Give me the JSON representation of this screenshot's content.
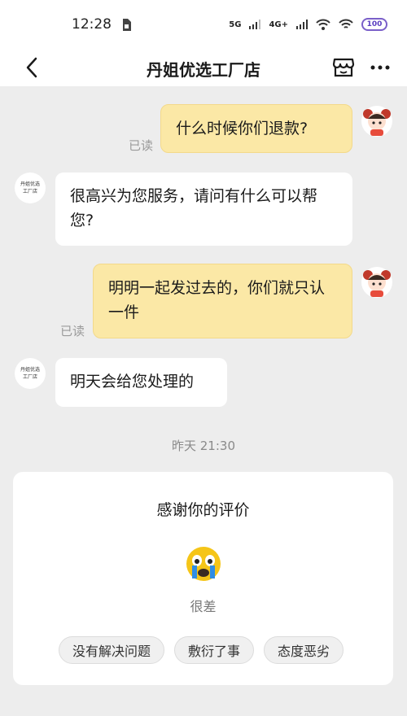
{
  "status_bar": {
    "time": "12:28",
    "network_1": "5G",
    "network_2": "4G+",
    "battery": "100"
  },
  "header": {
    "title": "丹姐优选工厂店"
  },
  "messages": [
    {
      "direction": "out",
      "text": "什么时候你们退款?",
      "read_label": "已读"
    },
    {
      "direction": "in",
      "text": "很高兴为您服务，请问有什么可以帮您?"
    },
    {
      "direction": "out",
      "text": "明明一起发过去的，你们就只认一件",
      "read_label": "已读"
    },
    {
      "direction": "in",
      "text": "明天会给您处理的"
    }
  ],
  "shop_avatar": {
    "line1": "丹姐优选",
    "line2": "工厂店"
  },
  "timestamp": "昨天 21:30",
  "review": {
    "title": "感谢你的评价",
    "rating_label": "很差",
    "tags": [
      "没有解决问题",
      "敷衍了事",
      "态度恶劣"
    ]
  },
  "colors": {
    "outgoing_bubble": "#fbe8a6",
    "incoming_bubble": "#ffffff",
    "background": "#ededed"
  }
}
